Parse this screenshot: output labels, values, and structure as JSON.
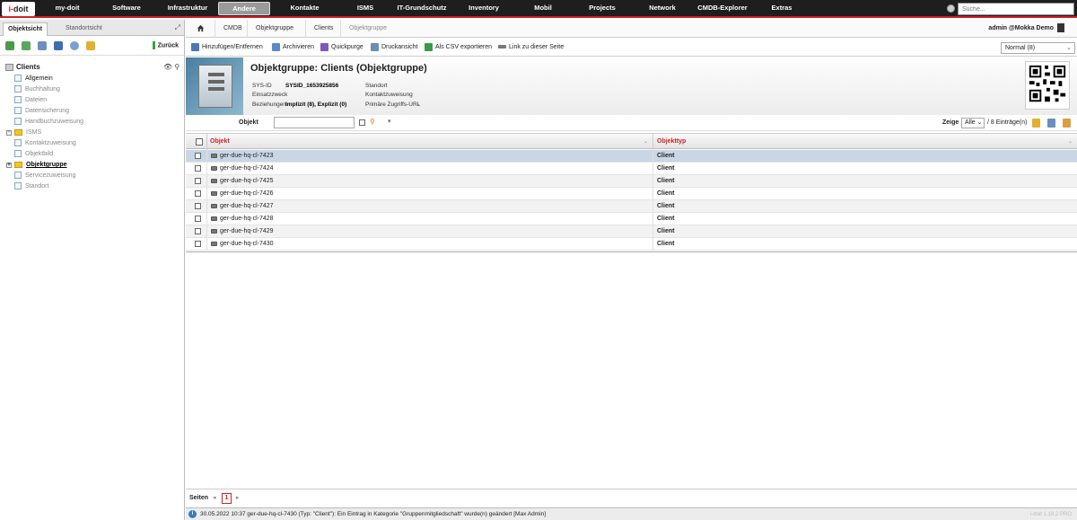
{
  "logo": {
    "main": "doit",
    "prefix": "i-"
  },
  "nav": [
    {
      "label": "my-doit",
      "active": false
    },
    {
      "label": "Software",
      "active": false
    },
    {
      "label": "Infrastruktur",
      "active": false
    },
    {
      "label": "Andere",
      "active": true
    },
    {
      "label": "Kontakte",
      "active": false
    },
    {
      "label": "ISMS",
      "active": false
    },
    {
      "label": "IT-Grundschutz",
      "active": false
    },
    {
      "label": "Inventory",
      "active": false
    },
    {
      "label": "Mobil",
      "active": false
    },
    {
      "label": "Projects",
      "active": false
    },
    {
      "label": "Network",
      "active": false
    },
    {
      "label": "CMDB-Explorer",
      "active": false
    },
    {
      "label": "Extras",
      "active": false
    }
  ],
  "search": {
    "placeholder": "Suche..."
  },
  "left": {
    "tab_active": "Objektsicht",
    "tab_inactive": "Standortsicht",
    "back_label": "Zurück",
    "tree_root": "Clients",
    "tree_items": [
      {
        "label": "Allgemein",
        "state": "filled",
        "folder": false
      },
      {
        "label": "Buchhaltung",
        "state": "empty",
        "folder": false
      },
      {
        "label": "Dateien",
        "state": "empty",
        "folder": false
      },
      {
        "label": "Datensicherung",
        "state": "empty",
        "folder": false
      },
      {
        "label": "Handbuchzuweisung",
        "state": "empty",
        "folder": false
      },
      {
        "label": "ISMS",
        "state": "empty",
        "folder": true
      },
      {
        "label": "Kontaktzuweisung",
        "state": "empty",
        "folder": false
      },
      {
        "label": "Objektbild",
        "state": "empty",
        "folder": false
      },
      {
        "label": "Objektgruppe",
        "state": "current",
        "folder": true
      },
      {
        "label": "Servicezuweisung",
        "state": "empty",
        "folder": false
      },
      {
        "label": "Standort",
        "state": "empty",
        "folder": false
      }
    ]
  },
  "breadcrumb": {
    "items": [
      "CMDB",
      "Objektgruppe",
      "Clients",
      "Objektgruppe"
    ]
  },
  "user": {
    "label": "admin  @Mokka Demo"
  },
  "actions": [
    {
      "label": "Hinzufügen/Entfernen",
      "color": "#4a78b8"
    },
    {
      "label": "Archivieren",
      "color": "#5a8acb"
    },
    {
      "label": "Quickpurge",
      "color": "#7a5ab8"
    },
    {
      "label": "Druckansicht",
      "color": "#6a8fb0"
    },
    {
      "label": "Als CSV exportieren",
      "color": "#3a9a4a"
    },
    {
      "label": "Link zu dieser Seite",
      "color": "#777777"
    }
  ],
  "mode_select": {
    "value": "Normal (8)"
  },
  "header": {
    "title": "Objektgruppe: Clients (Objektgruppe)",
    "sysid_label": "SYS-ID",
    "sysid_value": "SYSID_1653925856",
    "purpose_label": "Einsatzzweck",
    "relations_label": "Beziehungen",
    "relations_value": "Implizit (8), Explizit (0)",
    "location_label": "Standort",
    "contact_label": "Kontaktzuweisung",
    "url_label": "Primäre Zugriffs-URL",
    "url_value": "-"
  },
  "filter": {
    "label": "Objekt",
    "value": "",
    "show_label": "Zeige",
    "show_value": "Alle",
    "count": "/ 8 Einträge(n)"
  },
  "table": {
    "col_object": "Objekt",
    "col_type": "Objekttyp",
    "rows": [
      {
        "name": "ger-due-hq-cl-7423",
        "type": "Client"
      },
      {
        "name": "ger-due-hq-cl-7424",
        "type": "Client"
      },
      {
        "name": "ger-due-hq-cl-7425",
        "type": "Client"
      },
      {
        "name": "ger-due-hq-cl-7426",
        "type": "Client"
      },
      {
        "name": "ger-due-hq-cl-7427",
        "type": "Client"
      },
      {
        "name": "ger-due-hq-cl-7428",
        "type": "Client"
      },
      {
        "name": "ger-due-hq-cl-7429",
        "type": "Client"
      },
      {
        "name": "ger-due-hq-cl-7430",
        "type": "Client"
      }
    ]
  },
  "pager": {
    "label": "Seiten",
    "current": "1"
  },
  "status": {
    "text": "30.05.2022 10:37 ger-due-hq-cl-7430 (Typ: \"Client\"): Ein Eintrag in Kategorie \"Gruppenmitgliedschaft\" wurde(n) geändert [Max Admin]",
    "version": "i-doit 1.18.2 PRO"
  }
}
